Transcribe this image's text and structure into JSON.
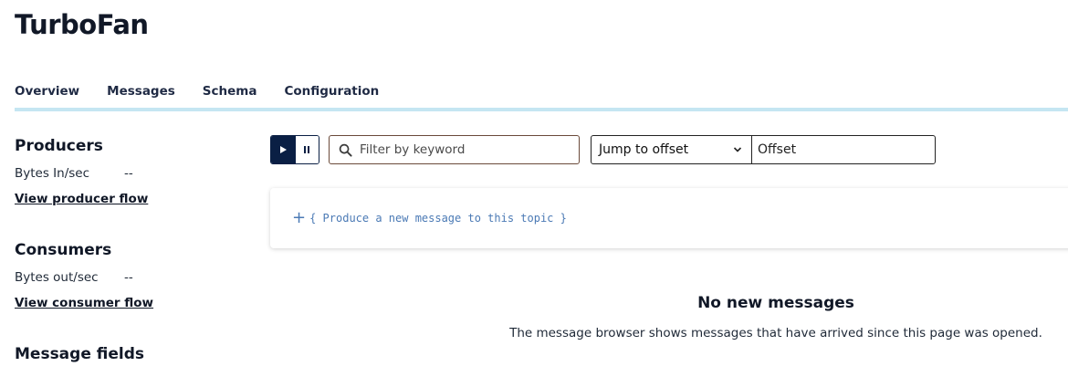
{
  "title": "TurboFan",
  "tabs": [
    {
      "label": "Overview",
      "active": false
    },
    {
      "label": "Messages",
      "active": true
    },
    {
      "label": "Schema",
      "active": false
    },
    {
      "label": "Configuration",
      "active": false
    }
  ],
  "sidebar": {
    "producers": {
      "heading": "Producers",
      "metric_label": "Bytes In/sec",
      "metric_value": "--",
      "link": "View producer flow"
    },
    "consumers": {
      "heading": "Consumers",
      "metric_label": "Bytes out/sec",
      "metric_value": "--",
      "link": "View consumer flow"
    },
    "message_fields": {
      "heading": "Message fields"
    }
  },
  "toolbar": {
    "play_icon": "play-icon",
    "pause_icon": "pause-icon",
    "search_placeholder": "Filter by keyword",
    "jump_label": "Jump to offset",
    "offset_placeholder": "Offset"
  },
  "produce": {
    "plus": "+",
    "text": "{ Produce a new message to this topic }"
  },
  "empty": {
    "title": "No new messages",
    "description": "The message browser shows messages that have arrived since this page was opened."
  },
  "colors": {
    "accent": "#0a1f44",
    "tab_rule": "#c5e6f2",
    "link_code": "#4b7ab5"
  }
}
